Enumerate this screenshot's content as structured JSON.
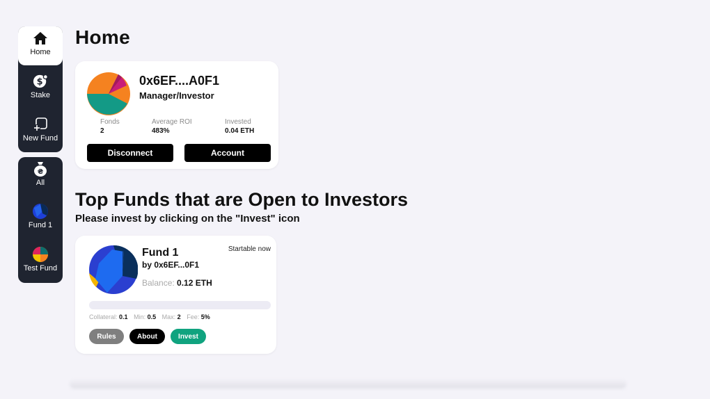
{
  "sidebar": {
    "top_items": [
      {
        "label": "Home",
        "icon": "home-icon",
        "active": true
      },
      {
        "label": "Stake",
        "icon": "dollar-coin-icon"
      },
      {
        "label": "New Fund",
        "icon": "add-fund-icon"
      }
    ],
    "bottom_items": [
      {
        "label": "All",
        "icon": "money-bag-icon"
      },
      {
        "label": "Fund 1",
        "icon": "fund-avatar-icon"
      },
      {
        "label": "Test Fund",
        "icon": "fund-avatar-icon"
      }
    ]
  },
  "page": {
    "title": "Home"
  },
  "account": {
    "address": "0x6EF....A0F1",
    "role": "Manager/Investor",
    "stats": [
      {
        "label": "Fonds",
        "value": "2"
      },
      {
        "label": "Average ROI",
        "value": "483%"
      },
      {
        "label": "Invested",
        "value": "0.04 ETH"
      }
    ],
    "disconnect_label": "Disconnect",
    "account_label": "Account"
  },
  "top_funds": {
    "title": "Top Funds that are Open to Investors",
    "subtitle": "Please invest by clicking on the \"Invest\" icon"
  },
  "fund": {
    "name": "Fund 1",
    "by": "by 0x6EF...0F1",
    "status": "Startable now",
    "balance_label": "Balance:",
    "balance_value": "0.12 ETH",
    "progress": 0,
    "params": [
      {
        "label": "Collateral:",
        "value": "0.1"
      },
      {
        "label": "Min:",
        "value": "0.5"
      },
      {
        "label": "Max:",
        "value": "2"
      },
      {
        "label": "Fee:",
        "value": "5%"
      }
    ],
    "rules_label": "Rules",
    "about_label": "About",
    "invest_label": "Invest"
  },
  "colors": {
    "sidebar_bg": "#1f2430",
    "invest_green": "#10a37f",
    "page_bg": "#f4f3f9"
  }
}
